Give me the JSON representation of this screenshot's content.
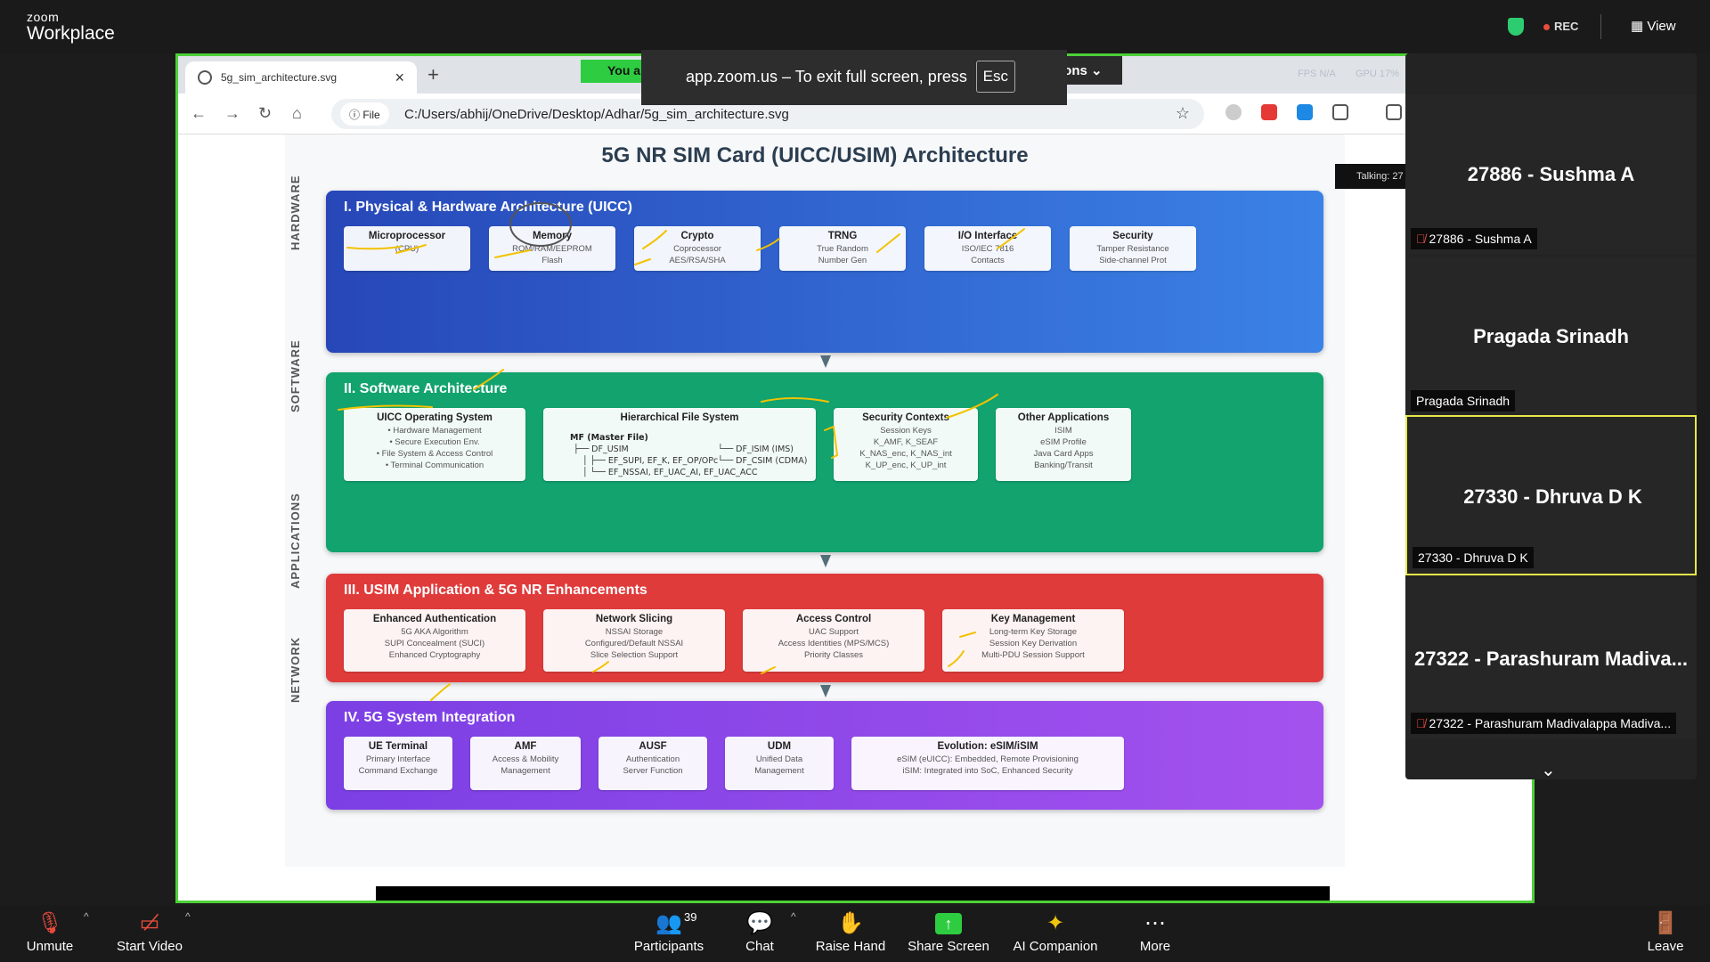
{
  "zoom": {
    "brand_small": "zoom",
    "brand_big": "Workplace",
    "rec_label": "REC",
    "view_label": "View"
  },
  "browser": {
    "tab_title": "5g_sim_architecture.svg",
    "you_badge": "You a",
    "options_label": "ions",
    "fps_text": "FPS N/A",
    "gpu_text": "GPU 17%",
    "file_label": "File",
    "url": "C:/Users/abhij/OneDrive/Desktop/Adhar/5g_sim_architecture.svg",
    "fullscreen_msg": "app.zoom.us – To exit full screen, press",
    "esc_key": "Esc"
  },
  "diagram": {
    "title": "5G NR SIM Card (UICC/USIM) Architecture",
    "side_labels": [
      "HARDWARE",
      "SOFTWARE",
      "APPLICATIONS",
      "NETWORK"
    ],
    "layers": [
      {
        "title": "I. Physical & Hardware Architecture (UICC)",
        "color": "#2f5fd6",
        "cards": [
          {
            "name": "Microprocessor",
            "l1": "(CPU)",
            "l2": ""
          },
          {
            "name": "Memory",
            "l1": "ROM/RAM/EEPROM",
            "l2": "Flash"
          },
          {
            "name": "Crypto",
            "l1": "Coprocessor",
            "l2": "AES/RSA/SHA"
          },
          {
            "name": "TRNG",
            "l1": "True Random",
            "l2": "Number Gen"
          },
          {
            "name": "I/O Interface",
            "l1": "ISO/IEC 7816",
            "l2": "Contacts"
          },
          {
            "name": "Security",
            "l1": "Tamper Resistance",
            "l2": "Side-channel Prot"
          }
        ]
      },
      {
        "title": "II. Software Architecture",
        "color": "#12a36e",
        "os": {
          "name": "UICC Operating System",
          "lines": [
            "• Hardware Management",
            "• Secure Execution Env.",
            "• File System & Access Control",
            "• Terminal Communication"
          ]
        },
        "fs": {
          "name": "Hierarchical File System",
          "mf": "MF (Master File)",
          "lines": [
            "├── DF_USIM",
            "│  ├── EF_SUPI, EF_K, EF_OP/OPc",
            "│  └── EF_NSSAI, EF_UAC_AI, EF_UAC_ACC"
          ],
          "right": [
            "└── DF_ISIM (IMS)",
            "└── DF_CSIM (CDMA)"
          ]
        },
        "sec": {
          "name": "Security Contexts",
          "lines": [
            "Session Keys",
            "K_AMF, K_SEAF",
            "K_NAS_enc, K_NAS_int",
            "K_UP_enc, K_UP_int"
          ]
        },
        "other": {
          "name": "Other Applications",
          "lines": [
            "ISIM",
            "eSIM Profile",
            "Java Card Apps",
            "Banking/Transit"
          ]
        }
      },
      {
        "title": "III. USIM Application & 5G NR Enhancements",
        "color": "#e03b3b",
        "cards": [
          {
            "name": "Enhanced Authentication",
            "lines": [
              "5G AKA Algorithm",
              "SUPI Concealment (SUCI)",
              "Enhanced Cryptography"
            ]
          },
          {
            "name": "Network Slicing",
            "lines": [
              "NSSAI Storage",
              "Configured/Default NSSAI",
              "Slice Selection Support"
            ]
          },
          {
            "name": "Access Control",
            "lines": [
              "UAC Support",
              "Access Identities (MPS/MCS)",
              "Priority Classes"
            ]
          },
          {
            "name": "Key Management",
            "lines": [
              "Long-term Key Storage",
              "Session Key Derivation",
              "Multi-PDU Session Support"
            ]
          }
        ]
      },
      {
        "title": "IV. 5G System Integration",
        "color": "#8c4ee8",
        "cards": [
          {
            "name": "UE Terminal",
            "l1": "Primary Interface",
            "l2": "Command Exchange"
          },
          {
            "name": "AMF",
            "l1": "Access & Mobility",
            "l2": "Management"
          },
          {
            "name": "AUSF",
            "l1": "Authentication",
            "l2": "Server Function"
          },
          {
            "name": "UDM",
            "l1": "Unified Data",
            "l2": "Management"
          },
          {
            "name": "Evolution: eSIM/iSIM",
            "l1": "eSIM (eUICC): Embedded, Remote Provisioning",
            "l2": "iSIM: Integrated into SoC, Enhanced Security"
          }
        ]
      }
    ]
  },
  "participants": {
    "talking": "Talking: 27",
    "tiles": [
      {
        "name": "27886 - Sushma A",
        "label": "27886 - Sushma A",
        "muted": true
      },
      {
        "name": "Pragada Srinadh",
        "label": "Pragada Srinadh",
        "muted": false
      },
      {
        "name": "27330 - Dhruva D K",
        "label": "27330 - Dhruva D K",
        "muted": false
      },
      {
        "name": "27322 - Parashuram Madiva...",
        "label": "27322 - Parashuram Madivalappa Madiva...",
        "muted": true
      }
    ]
  },
  "toolbar": {
    "unmute": "Unmute",
    "start_video": "Start Video",
    "participants": "Participants",
    "participants_count": "39",
    "chat": "Chat",
    "raise_hand": "Raise Hand",
    "share_screen": "Share Screen",
    "ai_companion": "AI Companion",
    "more": "More",
    "leave": "Leave"
  }
}
